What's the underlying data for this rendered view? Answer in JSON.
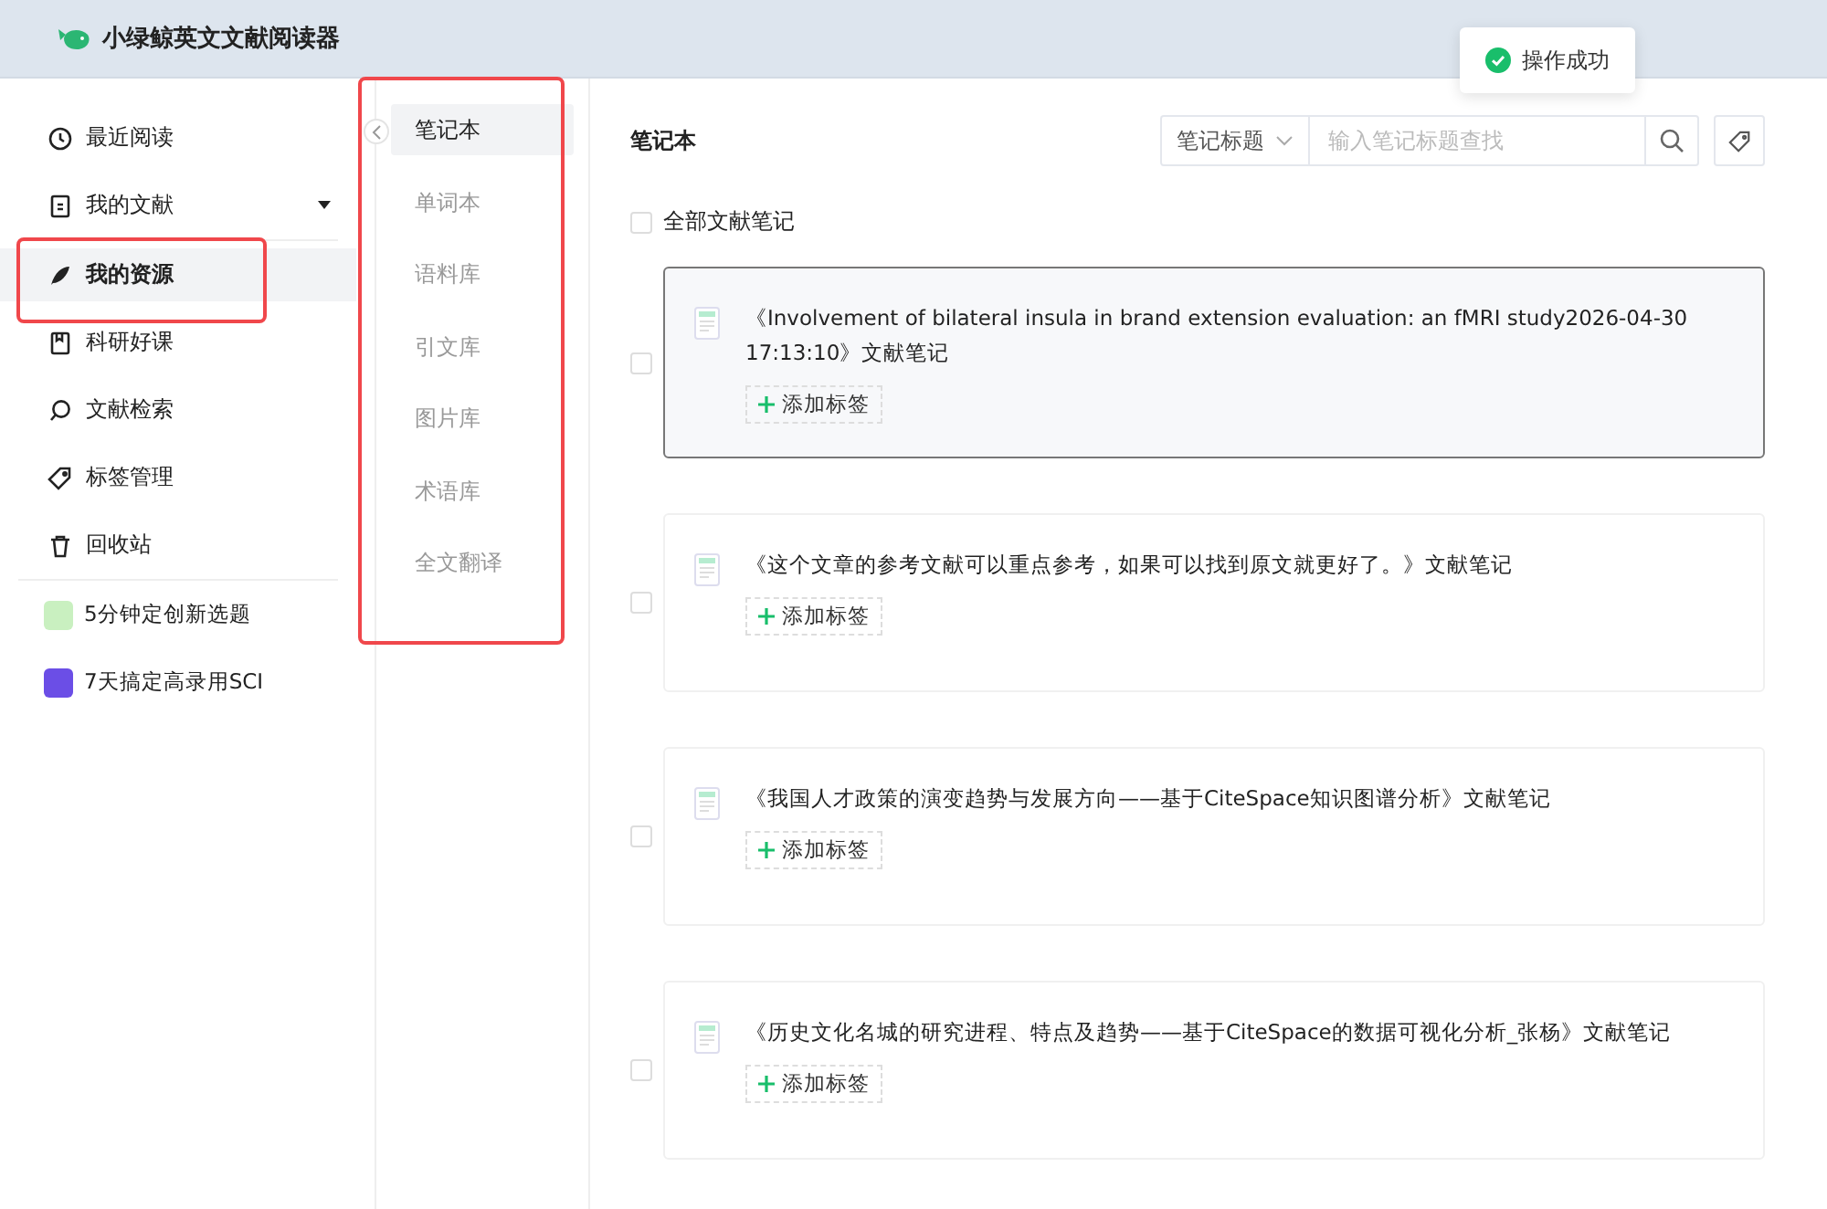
{
  "app": {
    "title": "小绿鲸英文文献阅读器"
  },
  "toast": {
    "message": "操作成功"
  },
  "sidebar": {
    "items": [
      {
        "label": "最近阅读",
        "selected": false,
        "kind": "link"
      },
      {
        "label": "我的文献",
        "selected": false,
        "kind": "dropdown"
      },
      {
        "label": "我的资源",
        "selected": true,
        "kind": "link"
      },
      {
        "label": "科研好课",
        "selected": false,
        "kind": "link"
      },
      {
        "label": "文献检索",
        "selected": false,
        "kind": "link"
      },
      {
        "label": "标签管理",
        "selected": false,
        "kind": "link"
      },
      {
        "label": "回收站",
        "selected": false,
        "kind": "link"
      }
    ],
    "promos": [
      {
        "label": "5分钟定创新选题",
        "color": "#c9f0c0"
      },
      {
        "label": "7天搞定高录用SCI",
        "color": "#6b4ee6"
      }
    ]
  },
  "subnav": {
    "items": [
      {
        "label": "笔记本",
        "selected": true
      },
      {
        "label": "单词本",
        "selected": false
      },
      {
        "label": "语料库",
        "selected": false
      },
      {
        "label": "引文库",
        "selected": false
      },
      {
        "label": "图片库",
        "selected": false
      },
      {
        "label": "术语库",
        "selected": false
      },
      {
        "label": "全文翻译",
        "selected": false
      }
    ]
  },
  "main": {
    "title": "笔记本",
    "filter": {
      "value": "笔记标题"
    },
    "search": {
      "placeholder": "输入笔记标题查找"
    },
    "select_all": {
      "label": "全部文献笔记",
      "checked": false
    },
    "notes": [
      {
        "title": "《Involvement of bilateral insula in brand extension evaluation: an fMRI study2026-04-30 17:13:10》文献笔记",
        "selected": true,
        "checked": false,
        "tag_button": "添加标签"
      },
      {
        "title": "《这个文章的参考文献可以重点参考，如果可以找到原文就更好了。》文献笔记",
        "selected": false,
        "checked": false,
        "tag_button": "添加标签"
      },
      {
        "title": "《我国人才政策的演变趋势与发展方向——基于CiteSpace知识图谱分析》文献笔记",
        "selected": false,
        "checked": false,
        "tag_button": "添加标签"
      },
      {
        "title": "《历史文化名城的研究进程、特点及趋势——基于CiteSpace的数据可视化分析_张杨》文献笔记",
        "selected": false,
        "checked": false,
        "tag_button": "添加标签"
      }
    ]
  }
}
